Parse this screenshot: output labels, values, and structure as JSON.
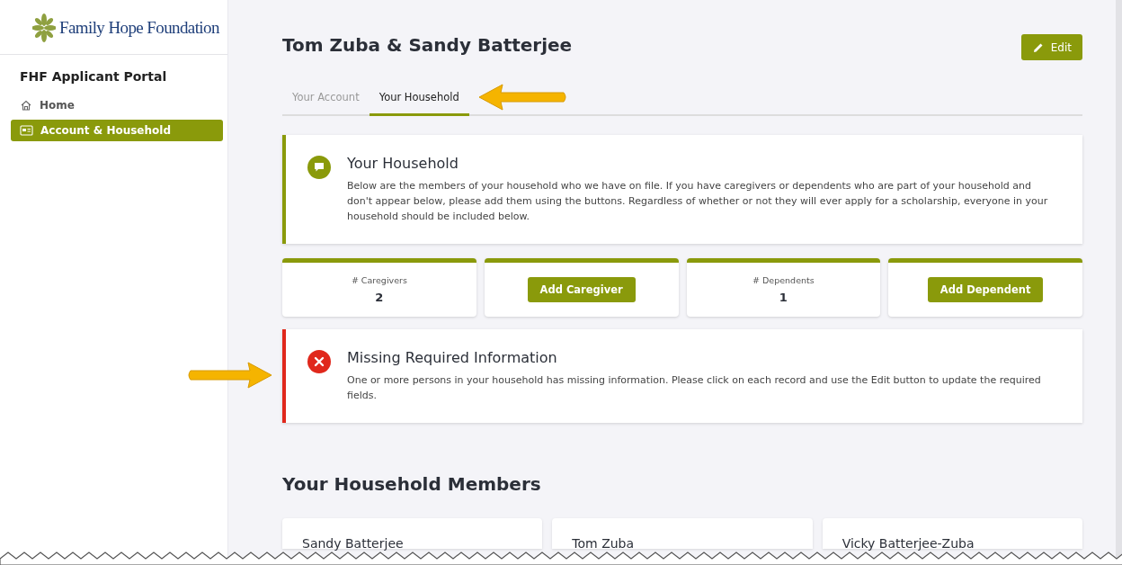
{
  "sidebar": {
    "logo": "Family Hope Foundation",
    "title": "FHF Applicant Portal",
    "items": [
      {
        "label": "Home",
        "kind": "home",
        "selected": false
      },
      {
        "label": "Account & Household",
        "kind": "card",
        "selected": true
      }
    ]
  },
  "header": {
    "title": "Tom Zuba & Sandy Batterjee",
    "edit_button": "Edit"
  },
  "tabs": [
    {
      "label": "Your Account",
      "selected": false
    },
    {
      "label": "Your Household",
      "selected": true
    }
  ],
  "alerts": [
    {
      "kind": "info",
      "title": "Your Household",
      "text": "Below are the members of your household who we have on file. If you have caregivers or dependents who are part of your household and don't appear below, please add them using the buttons. Regardless of whether or not they will ever apply for a scholarship, everyone in your household should be included below."
    }
  ],
  "stats": [
    {
      "kind": "count",
      "label": "# Caregivers",
      "value": "2"
    },
    {
      "kind": "action",
      "label": "Add Caregiver"
    },
    {
      "kind": "count",
      "label": "# Dependents",
      "value": "1"
    },
    {
      "kind": "action",
      "label": "Add Dependent"
    }
  ],
  "errors": [
    {
      "kind": "error",
      "title": "Missing Required Information",
      "text": "One or more persons in your household has missing information. Please click on each record and use the Edit button to update the required fields."
    }
  ],
  "members_section": {
    "title": "Your Household Members",
    "members": [
      {
        "name": "Sandy Batterjee"
      },
      {
        "name": "Tom Zuba"
      },
      {
        "name": "Vicky Batterjee-Zuba"
      }
    ]
  }
}
